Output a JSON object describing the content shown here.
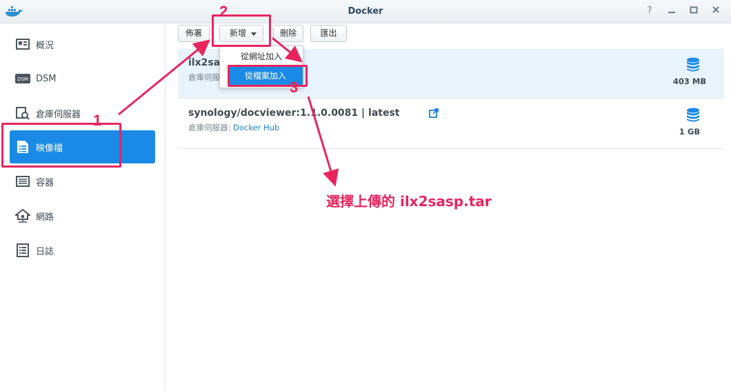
{
  "window": {
    "title": "Docker"
  },
  "sidebar": {
    "items": [
      {
        "label": "概況",
        "icon": "overview-icon"
      },
      {
        "label": "DSM",
        "icon": "dsm-icon"
      },
      {
        "label": "倉庫伺服器",
        "icon": "registry-icon"
      },
      {
        "label": "映像檔",
        "icon": "image-icon",
        "active": true
      },
      {
        "label": "容器",
        "icon": "container-icon"
      },
      {
        "label": "網路",
        "icon": "network-icon"
      },
      {
        "label": "日誌",
        "icon": "log-icon"
      }
    ]
  },
  "toolbar": {
    "deploy_label": "佈署",
    "add_label": "新增",
    "delete_label": "刪除",
    "export_label": "匯出"
  },
  "dropdown": {
    "items": [
      {
        "label": "從網址加入"
      },
      {
        "label": "從檔案加入",
        "selected": true
      }
    ]
  },
  "images": [
    {
      "name": "ilx2sa",
      "registry_label": "倉庫伺服",
      "registry_value": "",
      "size": "403 MB",
      "selected": true
    },
    {
      "name": "synology/docviewer:1.1.0.0081 | latest",
      "registry_label": "倉庫伺服器: ",
      "registry_value": "Docker Hub",
      "size": "1 GB",
      "selected": false
    }
  ],
  "annotations": {
    "step1": "1",
    "step2": "2",
    "step3": "3",
    "note": "選擇上傳的 ilx2sasp.tar"
  },
  "colors": {
    "accent": "#1a8ae6",
    "annotation": "#e8245e"
  }
}
